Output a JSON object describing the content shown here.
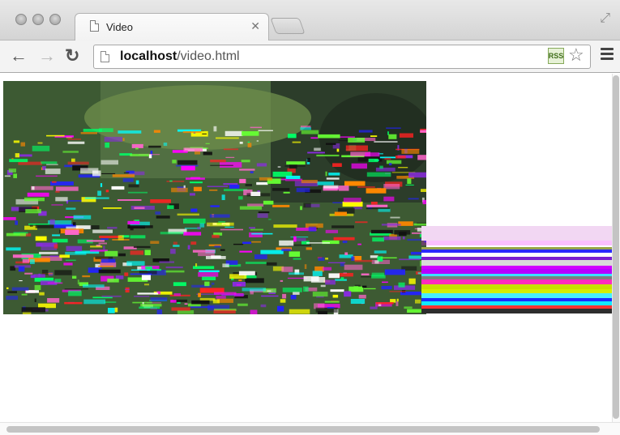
{
  "window": {
    "tab_title": "Video",
    "url_host": "localhost",
    "url_path": "/video.html"
  },
  "icons": {
    "back": "back-arrow-icon",
    "forward": "forward-arrow-icon",
    "reload": "reload-icon",
    "page": "page-icon",
    "extension": "rss-extension-icon",
    "bookmark": "star-icon",
    "menu": "hamburger-menu-icon"
  },
  "colors": {
    "chrome_bg": "#d4d4d4",
    "toolbar_bg": "#f3f3f3",
    "content_bg": "#ffffff"
  }
}
